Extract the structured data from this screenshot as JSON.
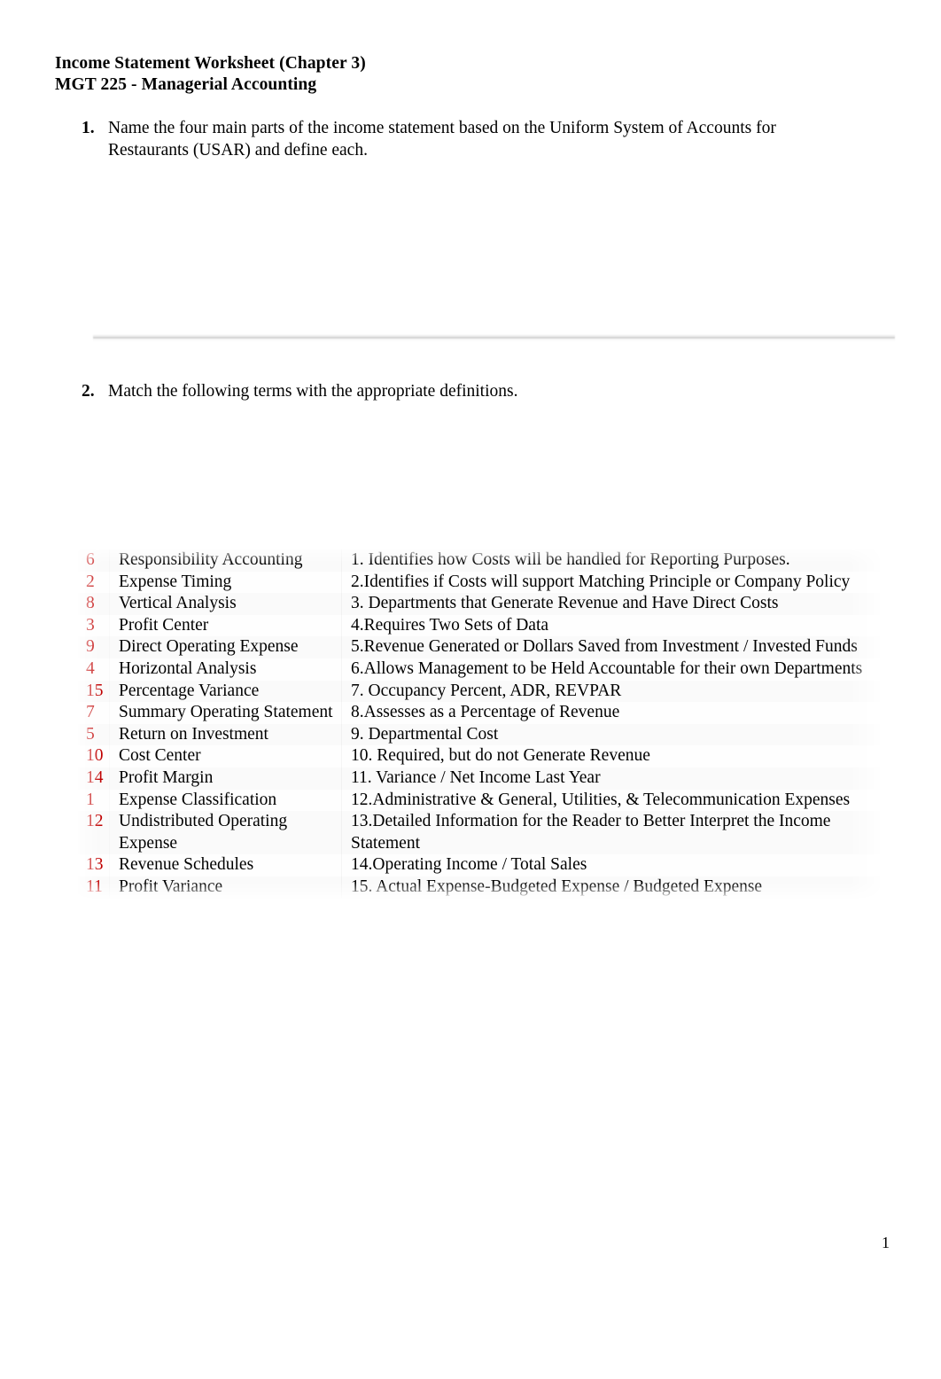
{
  "document": {
    "title_line1": "Income Statement Worksheet (Chapter 3)",
    "title_line2": "MGT 225 - Managerial Accounting",
    "page_number": "1"
  },
  "questions": [
    {
      "number": "1.",
      "text": "Name the four main parts of the income statement based on the Uniform System of Accounts for Restaurants (USAR) and define each."
    },
    {
      "number": "2.",
      "text": "Match the following terms with the appropriate definitions."
    }
  ],
  "matching": {
    "answer_color": "#C00000",
    "rows": [
      {
        "answer": "6",
        "term": "Responsibility Accounting",
        "definition": "1. Identifies how Costs will be handled for Reporting Purposes."
      },
      {
        "answer": "2",
        "term": "Expense Timing",
        "definition": "2.Identifies if Costs will support Matching Principle or Company Policy"
      },
      {
        "answer": "8",
        "term": "Vertical Analysis",
        "definition": "3. Departments that Generate Revenue and Have Direct Costs"
      },
      {
        "answer": "3",
        "term": "Profit Center",
        "definition": "4.Requires Two Sets of Data"
      },
      {
        "answer": "9",
        "term": "Direct Operating Expense",
        "definition": "5.Revenue Generated or Dollars Saved from Investment / Invested Funds"
      },
      {
        "answer": "4",
        "term": "Horizontal Analysis",
        "definition": "6.Allows Management to be Held Accountable for their own Departments"
      },
      {
        "answer": "15",
        "term": "Percentage Variance",
        "definition": "7. Occupancy Percent, ADR, REVPAR"
      },
      {
        "answer": "7",
        "term": "Summary Operating Statement",
        "definition": "8.Assesses as a Percentage of Revenue"
      },
      {
        "answer": "5",
        "term": "Return on Investment",
        "definition": "9. Departmental Cost"
      },
      {
        "answer": "10",
        "term": "Cost Center",
        "definition": "10. Required, but do not Generate Revenue"
      },
      {
        "answer": "14",
        "term": "Profit Margin",
        "definition": "11. Variance / Net Income Last Year"
      },
      {
        "answer": "1",
        "term": "Expense Classification",
        "definition": "12.Administrative & General, Utilities, & Telecommunication Expenses"
      },
      {
        "answer": "12",
        "term": "Undistributed Operating Expense",
        "definition": "13.Detailed Information for the Reader to Better Interpret the Income Statement"
      },
      {
        "answer": "13",
        "term": "Revenue Schedules",
        "definition": "14.Operating Income / Total Sales"
      },
      {
        "answer": "11",
        "term": "Profit Variance",
        "definition": "15. Actual Expense-Budgeted Expense / Budgeted Expense"
      }
    ]
  }
}
